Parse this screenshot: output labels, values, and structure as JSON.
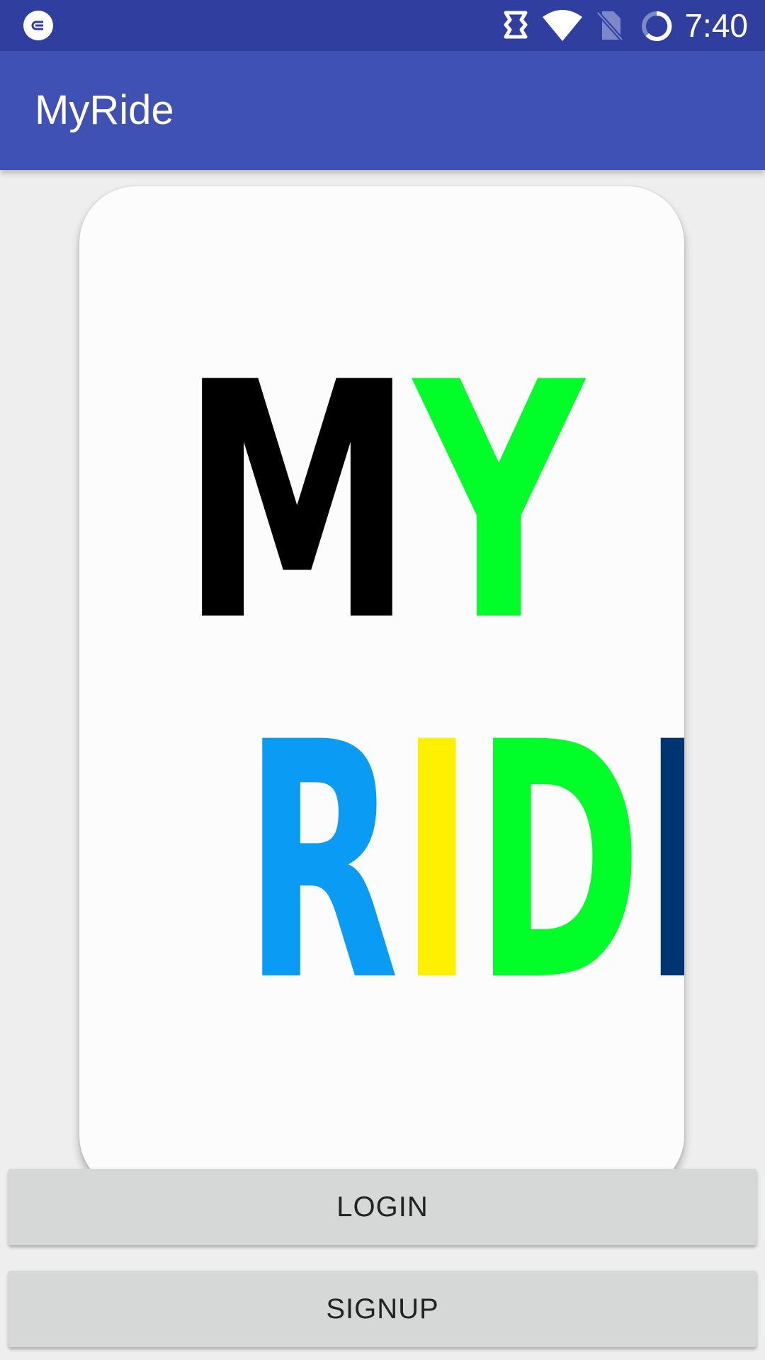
{
  "status_bar": {
    "time": "7:40",
    "icons": [
      "app-notification-icon",
      "tag-icon",
      "wifi-icon",
      "no-sim-icon",
      "battery-charging-icon"
    ],
    "background": "#303f9f"
  },
  "app_bar": {
    "title": "MyRide",
    "background": "#3f51b5"
  },
  "logo": {
    "line1": [
      {
        "char": "M",
        "color": "#000000"
      },
      {
        "char": "Y",
        "color": "#00ff28"
      }
    ],
    "line2": [
      {
        "char": "R",
        "color": "#0a9bf5"
      },
      {
        "char": "I",
        "color": "#fff000"
      },
      {
        "char": "D",
        "color": "#00ff28"
      },
      {
        "char": "E",
        "color": "#003573"
      }
    ]
  },
  "buttons": {
    "login_label": "LOGIN",
    "signup_label": "SIGNUP"
  }
}
